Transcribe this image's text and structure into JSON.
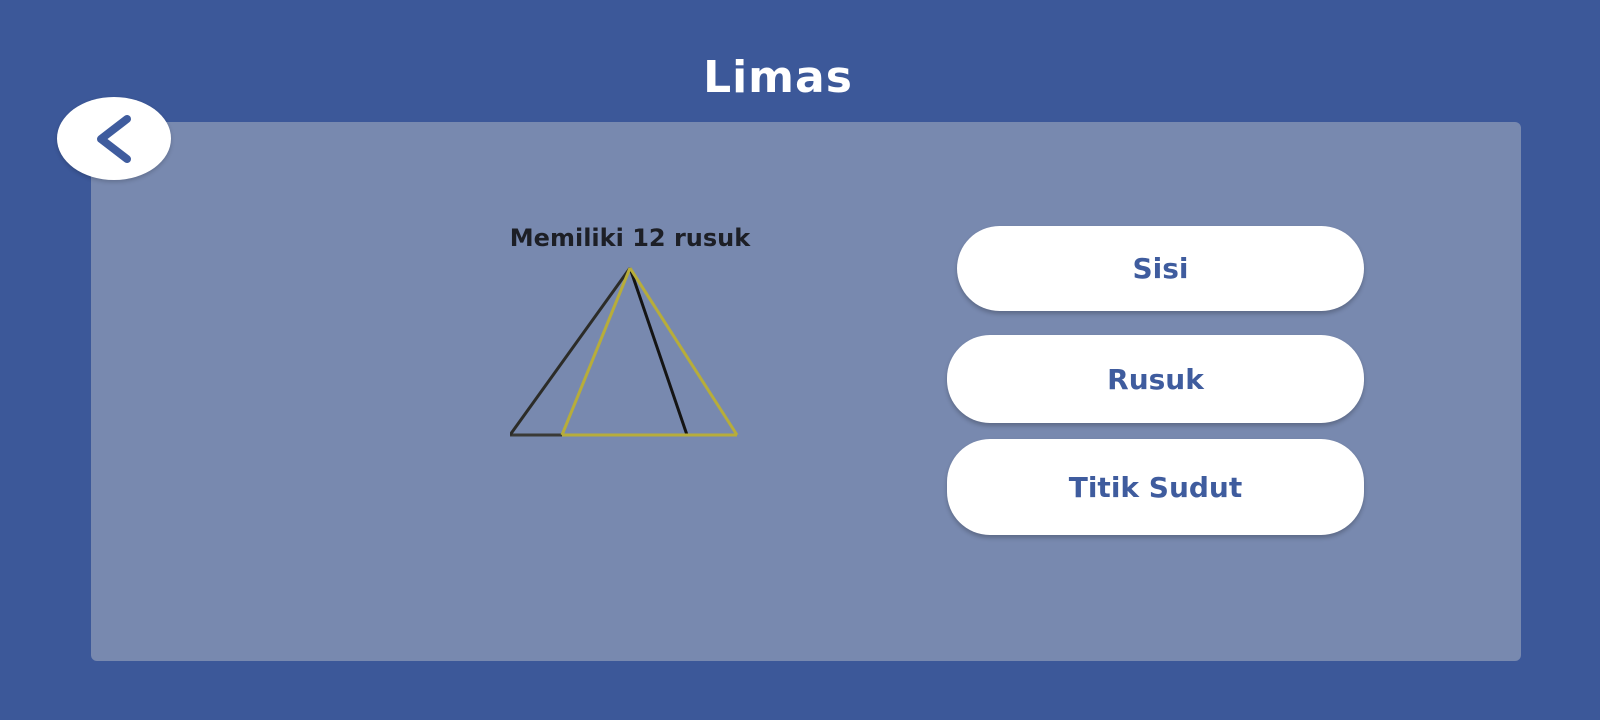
{
  "header": {
    "title": "Limas"
  },
  "navigation": {
    "back_icon": "chevron-left-icon"
  },
  "question": {
    "caption": "Memiliki 12 rusuk",
    "shape": "pyramid"
  },
  "choices": [
    {
      "label": "Sisi"
    },
    {
      "label": "Rusuk"
    },
    {
      "label": "Titik Sudut"
    }
  ],
  "colors": {
    "background": "#3c5899",
    "panel": "#7889af",
    "button": "#ffffff",
    "button_text": "#3f5c9e",
    "highlight_edges": "#b7ad3a",
    "edges": "#1d1f26"
  }
}
